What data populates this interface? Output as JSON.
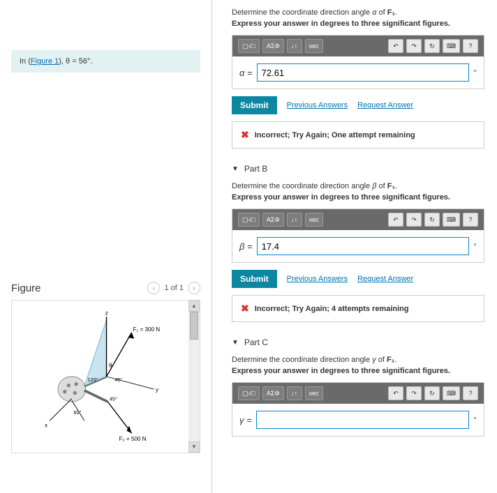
{
  "left": {
    "info_prefix": "In (",
    "info_link": "Figure 1",
    "info_suffix": "), θ = 56°.",
    "figure_title": "Figure",
    "page_text": "1 of 1",
    "fig_labels": {
      "z": "z",
      "y": "y",
      "x": "x",
      "f1": "F₁ = 300 N",
      "f2": "F₂ = 500 N",
      "theta": "θ",
      "a120": "120°",
      "a45a": "45°",
      "a45b": "45°",
      "a60": "60°"
    }
  },
  "partA": {
    "title_seg1": "Determine the coordinate direction angle ",
    "title_var": "α",
    "title_seg2": " of ",
    "title_vec": "F₁",
    "title_seg3": ".",
    "sub": "Express your answer in degrees to three significant figures.",
    "label": "α =",
    "value": "72.61",
    "unit": "°",
    "submit": "Submit",
    "prev": "Previous Answers",
    "req": "Request Answer",
    "feedback": "Incorrect; Try Again; One attempt remaining"
  },
  "partB": {
    "head": "Part B",
    "title_seg1": "Determine the coordinate direction angle ",
    "title_var": "β",
    "title_seg2": " of ",
    "title_vec": "F₁",
    "title_seg3": ".",
    "sub": "Express your answer in degrees to three significant figures.",
    "label": "β =",
    "value": "17.4",
    "unit": "°",
    "submit": "Submit",
    "prev": "Previous Answers",
    "req": "Request Answer",
    "feedback": "Incorrect; Try Again; 4 attempts remaining"
  },
  "partC": {
    "head": "Part C",
    "title_seg1": "Determine the coordinate direction angle ",
    "title_var": "γ",
    "title_seg2": " of ",
    "title_vec": "F₁",
    "title_seg3": ".",
    "sub": "Express your answer in degrees to three significant figures.",
    "label": "γ =",
    "value": "",
    "unit": "°"
  },
  "toolbar": {
    "b1": "▢√□",
    "b2": "ΑΣΦ",
    "b3": "↓↑",
    "b4": "vec",
    "undo": "↶",
    "redo": "↷",
    "reset": "↻",
    "kbd": "⌨",
    "help": "?"
  }
}
